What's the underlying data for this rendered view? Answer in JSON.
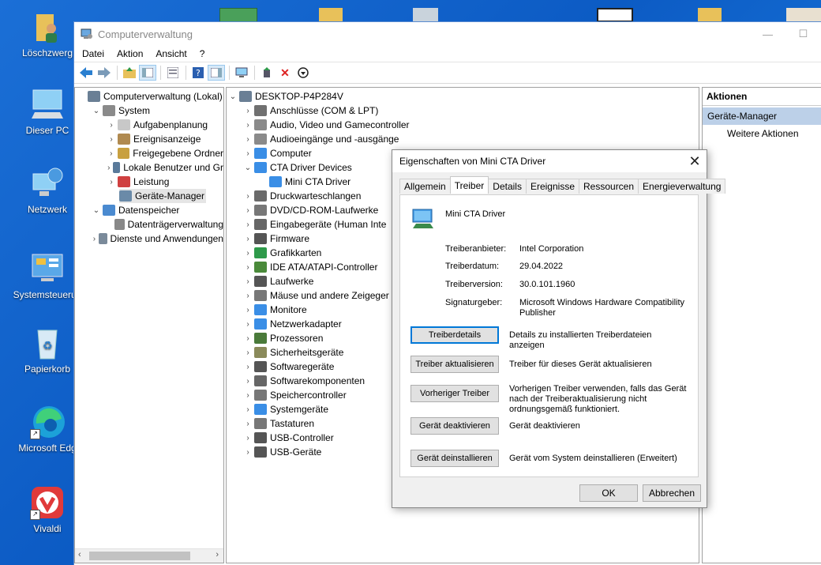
{
  "desktop": {
    "icons": [
      {
        "label": "Löschzwerg",
        "icon": "folder-user-icon"
      },
      {
        "label": "Dieser PC",
        "icon": "computer-icon"
      },
      {
        "label": "Netzwerk",
        "icon": "network-icon"
      },
      {
        "label": "Systemsteuerun",
        "icon": "control-panel-icon"
      },
      {
        "label": "Papierkorb",
        "icon": "recycle-bin-icon"
      },
      {
        "label": "Microsoft Edg",
        "icon": "edge-icon"
      },
      {
        "label": "Vivaldi",
        "icon": "vivaldi-icon"
      }
    ]
  },
  "window": {
    "title": "Computerverwaltung",
    "minimize": "—",
    "maximize": "☐"
  },
  "menu": [
    "Datei",
    "Aktion",
    "Ansicht",
    "?"
  ],
  "left_tree": [
    {
      "label": "Computerverwaltung (Lokal)",
      "level": 0,
      "chevron": ""
    },
    {
      "label": "System",
      "level": 1,
      "chevron": "⌄"
    },
    {
      "label": "Aufgabenplanung",
      "level": 2,
      "chevron": "›"
    },
    {
      "label": "Ereignisanzeige",
      "level": 2,
      "chevron": "›"
    },
    {
      "label": "Freigegebene Ordner",
      "level": 2,
      "chevron": "›"
    },
    {
      "label": "Lokale Benutzer und Gr",
      "level": 2,
      "chevron": "›"
    },
    {
      "label": "Leistung",
      "level": 2,
      "chevron": "›"
    },
    {
      "label": "Geräte-Manager",
      "level": 2,
      "chevron": "",
      "selected": true
    },
    {
      "label": "Datenspeicher",
      "level": 1,
      "chevron": "⌄"
    },
    {
      "label": "Datenträgerverwaltung",
      "level": 2,
      "chevron": ""
    },
    {
      "label": "Dienste und Anwendungen",
      "level": 1,
      "chevron": "›"
    }
  ],
  "device_tree": {
    "root": "DESKTOP-P4P284V",
    "items": [
      {
        "label": "Anschlüsse (COM & LPT)",
        "chevron": "›",
        "color": "#707070"
      },
      {
        "label": "Audio, Video und Gamecontroller",
        "chevron": "›",
        "color": "#8a8a8a"
      },
      {
        "label": "Audioeingänge und -ausgänge",
        "chevron": "›",
        "color": "#8a8a8a"
      },
      {
        "label": "Computer",
        "chevron": "›",
        "color": "#3a8ee6"
      },
      {
        "label": "CTA Driver Devices",
        "chevron": "⌄",
        "color": "#3a8ee6"
      },
      {
        "label": "Mini CTA Driver",
        "chevron": "",
        "color": "#3a8ee6",
        "child": true
      },
      {
        "label": "Druckwarteschlangen",
        "chevron": "›",
        "color": "#6a6a6a"
      },
      {
        "label": "DVD/CD-ROM-Laufwerke",
        "chevron": "›",
        "color": "#777"
      },
      {
        "label": "Eingabegeräte (Human Inte",
        "chevron": "›",
        "color": "#666"
      },
      {
        "label": "Firmware",
        "chevron": "›",
        "color": "#555"
      },
      {
        "label": "Grafikkarten",
        "chevron": "›",
        "color": "#2e9a4a"
      },
      {
        "label": "IDE ATA/ATAPI-Controller",
        "chevron": "›",
        "color": "#4a8a3a"
      },
      {
        "label": "Laufwerke",
        "chevron": "›",
        "color": "#555"
      },
      {
        "label": "Mäuse und andere Zeigeger",
        "chevron": "›",
        "color": "#777"
      },
      {
        "label": "Monitore",
        "chevron": "›",
        "color": "#3a8ee6"
      },
      {
        "label": "Netzwerkadapter",
        "chevron": "›",
        "color": "#3a8ee6"
      },
      {
        "label": "Prozessoren",
        "chevron": "›",
        "color": "#4a7a3a"
      },
      {
        "label": "Sicherheitsgeräte",
        "chevron": "›",
        "color": "#8a8a5a"
      },
      {
        "label": "Softwaregeräte",
        "chevron": "›",
        "color": "#555"
      },
      {
        "label": "Softwarekomponenten",
        "chevron": "›",
        "color": "#666"
      },
      {
        "label": "Speichercontroller",
        "chevron": "›",
        "color": "#777"
      },
      {
        "label": "Systemgeräte",
        "chevron": "›",
        "color": "#3a8ee6"
      },
      {
        "label": "Tastaturen",
        "chevron": "›",
        "color": "#777"
      },
      {
        "label": "USB-Controller",
        "chevron": "›",
        "color": "#555"
      },
      {
        "label": "USB-Geräte",
        "chevron": "›",
        "color": "#555"
      }
    ]
  },
  "actions_pane": {
    "header": "Aktionen",
    "section": "Geräte-Manager",
    "item": "Weitere Aktionen"
  },
  "dialog": {
    "title": "Eigenschaften von Mini CTA Driver",
    "close": "✕",
    "tabs": [
      "Allgemein",
      "Treiber",
      "Details",
      "Ereignisse",
      "Ressourcen",
      "Energieverwaltung"
    ],
    "active_tab": "Treiber",
    "device_name": "Mini CTA Driver",
    "info": [
      {
        "key": "Treiberanbieter:",
        "value": "Intel Corporation"
      },
      {
        "key": "Treiberdatum:",
        "value": "29.04.2022"
      },
      {
        "key": "Treiberversion:",
        "value": "30.0.101.1960"
      },
      {
        "key": "Signaturgeber:",
        "value": "Microsoft Windows Hardware Compatibility Publisher"
      }
    ],
    "actions": [
      {
        "button": "Treiberdetails",
        "desc": "Details zu installierten Treiberdateien anzeigen"
      },
      {
        "button": "Treiber aktualisieren",
        "desc": "Treiber für dieses Gerät aktualisieren"
      },
      {
        "button": "Vorheriger Treiber",
        "desc": "Vorherigen Treiber verwenden, falls das Gerät nach der Treiberaktualisierung nicht ordnungsgemäß funktioniert."
      },
      {
        "button": "Gerät deaktivieren",
        "desc": "Gerät deaktivieren"
      },
      {
        "button": "Gerät deinstallieren",
        "desc": "Gerät vom System deinstallieren (Erweitert)"
      }
    ],
    "ok": "OK",
    "cancel": "Abbrechen"
  }
}
